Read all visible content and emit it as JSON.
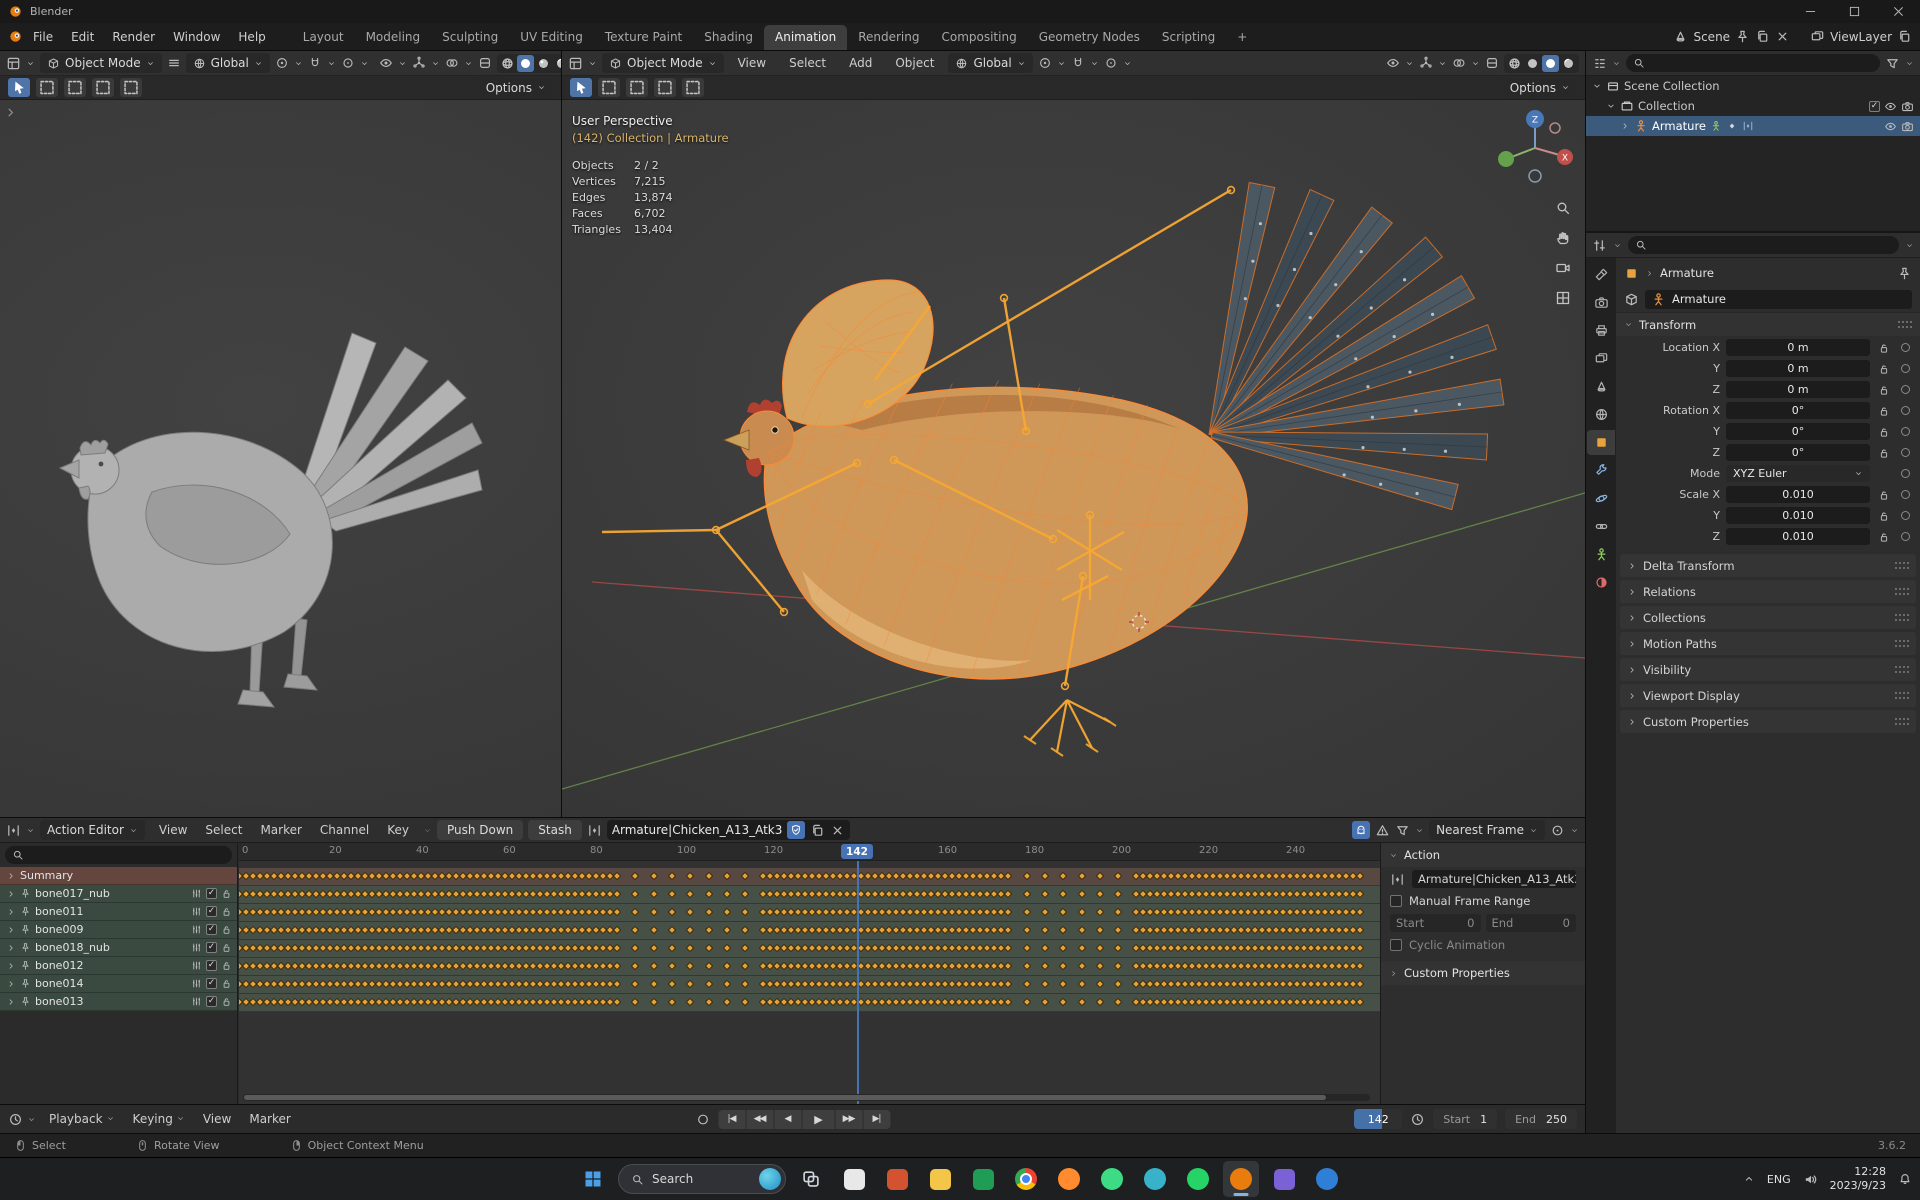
{
  "window": {
    "title": "Blender"
  },
  "topbar": {
    "menus": [
      "File",
      "Edit",
      "Render",
      "Window",
      "Help"
    ],
    "workspaces": [
      "Layout",
      "Modeling",
      "Sculpting",
      "UV Editing",
      "Texture Paint",
      "Shading",
      "Animation",
      "Rendering",
      "Compositing",
      "Geometry Nodes",
      "Scripting"
    ],
    "active_workspace": "Animation",
    "new_workspace_label": "+",
    "scene_label": "Scene",
    "viewlayer_label": "ViewLayer"
  },
  "viewport_left": {
    "mode": "Object Mode",
    "orientation": "Global",
    "options_label": "Options",
    "shading": "solid"
  },
  "viewport_right": {
    "mode": "Object Mode",
    "menus": [
      "View",
      "Select",
      "Add",
      "Object"
    ],
    "orientation": "Global",
    "options_label": "Options",
    "shading": "material",
    "view_name": "User Perspective",
    "context_line": "(142) Collection | Armature",
    "stats": [
      {
        "label": "Objects",
        "value": "2 / 2"
      },
      {
        "label": "Vertices",
        "value": "7,215"
      },
      {
        "label": "Edges",
        "value": "13,874"
      },
      {
        "label": "Faces",
        "value": "6,702"
      },
      {
        "label": "Triangles",
        "value": "13,404"
      }
    ],
    "axis_labels": {
      "x": "X",
      "z": "Z"
    }
  },
  "outliner": {
    "rows": [
      {
        "label": "Scene Collection",
        "icon": "scene-collection",
        "indent": 0,
        "selected": false,
        "expanded": true,
        "right_icons": []
      },
      {
        "label": "Collection",
        "icon": "collection",
        "indent": 1,
        "selected": false,
        "expanded": true,
        "right_icons": [
          "checkbox",
          "eye",
          "camera"
        ]
      },
      {
        "label": "Armature",
        "icon": "armature",
        "indent": 2,
        "selected": true,
        "expanded": false,
        "right_icons": [
          "eye",
          "camera"
        ]
      }
    ]
  },
  "properties": {
    "breadcrumb_object": "Armature",
    "datablock_name": "Armature",
    "transform_title": "Transform",
    "transform_rows": [
      {
        "label": "Location X",
        "value": "0 m"
      },
      {
        "label": "Y",
        "value": "0 m"
      },
      {
        "label": "Z",
        "value": "0 m"
      },
      {
        "label": "Rotation X",
        "value": "0°"
      },
      {
        "label": "Y",
        "value": "0°"
      },
      {
        "label": "Z",
        "value": "0°"
      },
      {
        "label": "Mode",
        "value": "XYZ Euler",
        "dropdown": true
      },
      {
        "label": "Scale X",
        "value": "0.010"
      },
      {
        "label": "Y",
        "value": "0.010"
      },
      {
        "label": "Z",
        "value": "0.010"
      }
    ],
    "collapsed_sections": [
      "Delta Transform",
      "Relations",
      "Collections",
      "Motion Paths",
      "Visibility",
      "Viewport Display",
      "Custom Properties"
    ],
    "tabs": [
      "tool",
      "render",
      "output",
      "view-layer",
      "scene",
      "world",
      "object",
      "modifiers",
      "physics",
      "constraints",
      "object-data",
      "material"
    ],
    "active_tab": "object"
  },
  "dopesheet": {
    "editor_mode": "Action Editor",
    "menus": [
      "View",
      "Select",
      "Marker",
      "Channel",
      "Key"
    ],
    "push_down_label": "Push Down",
    "stash_label": "Stash",
    "action_name": "Armature|Chicken_A13_Atk3",
    "snap_label": "Nearest Frame",
    "current_frame": 142,
    "ruler_ticks": [
      0,
      20,
      40,
      60,
      80,
      100,
      120,
      160,
      180,
      200,
      220,
      240
    ],
    "key_start_frame": 0,
    "key_end_frame": 258,
    "sparse_ranges": [
      [
        86,
        118
      ],
      [
        176,
        204
      ]
    ],
    "channels": [
      {
        "name": "Summary",
        "type": "summary"
      },
      {
        "name": "bone017_nub",
        "type": "bone"
      },
      {
        "name": "bone011",
        "type": "bone"
      },
      {
        "name": "bone009",
        "type": "bone"
      },
      {
        "name": "bone018_nub",
        "type": "bone"
      },
      {
        "name": "bone012",
        "type": "bone"
      },
      {
        "name": "bone014",
        "type": "bone"
      },
      {
        "name": "bone013",
        "type": "bone"
      }
    ]
  },
  "action_panel": {
    "title": "Action",
    "action_name": "Armature|Chicken_A13_Atk3",
    "manual_range_label": "Manual Frame Range",
    "start_label": "Start",
    "start_value": "0",
    "end_label": "End",
    "end_value": "0",
    "cyclic_label": "Cyclic Animation",
    "custom_props_label": "Custom Properties"
  },
  "playbar": {
    "menus": [
      "Playback",
      "Keying",
      "View",
      "Marker"
    ],
    "transport": [
      "jump-to-start",
      "jump-to-prev-keyframe",
      "play-reverse",
      "play",
      "jump-to-next-keyframe",
      "jump-to-end"
    ],
    "frame_value": "142",
    "start_label": "Start",
    "start_value": "1",
    "end_label": "End",
    "end_value": "250"
  },
  "statusbar": {
    "select_label": "Select",
    "rotate_label": "Rotate View",
    "context_label": "Object Context Menu",
    "version": "3.6.2"
  },
  "taskbar": {
    "search_label": "Search",
    "apps": [
      {
        "name": "task-view",
        "color": "#9fb6c6",
        "shape": "glyph"
      },
      {
        "name": "widgets",
        "color": "#e8e8e8",
        "shape": "square"
      },
      {
        "name": "powerpoint",
        "color": "#d35230",
        "shape": "square"
      },
      {
        "name": "file-explorer",
        "color": "#f3c64a",
        "shape": "square"
      },
      {
        "name": "excel",
        "color": "#1f9d55",
        "shape": "square"
      },
      {
        "name": "chrome",
        "color": "#e94335",
        "shape": "chrome"
      },
      {
        "name": "firefox",
        "color": "#ff8b2e",
        "shape": "circle"
      },
      {
        "name": "dev-app",
        "color": "#3ddc84",
        "shape": "circle"
      },
      {
        "name": "edge",
        "color": "#38b2c8",
        "shape": "circle"
      },
      {
        "name": "whatsapp",
        "color": "#25d366",
        "shape": "circle"
      },
      {
        "name": "blender",
        "color": "#e87d0d",
        "shape": "circle",
        "active": true
      },
      {
        "name": "photoshop",
        "color": "#7b61d6",
        "shape": "square"
      },
      {
        "name": "browser",
        "color": "#2f7fd6",
        "shape": "circle"
      }
    ],
    "tray": {
      "lang": "ENG",
      "time": "12:28",
      "date": "2023/9/23"
    }
  },
  "colors": {
    "accent_blue": "#4772b3",
    "blender_orange": "#e87d0d",
    "keyframe_orange": "#e3a33b",
    "context_yellow": "#d9b465",
    "outliner_select": "#3c5b7c"
  }
}
